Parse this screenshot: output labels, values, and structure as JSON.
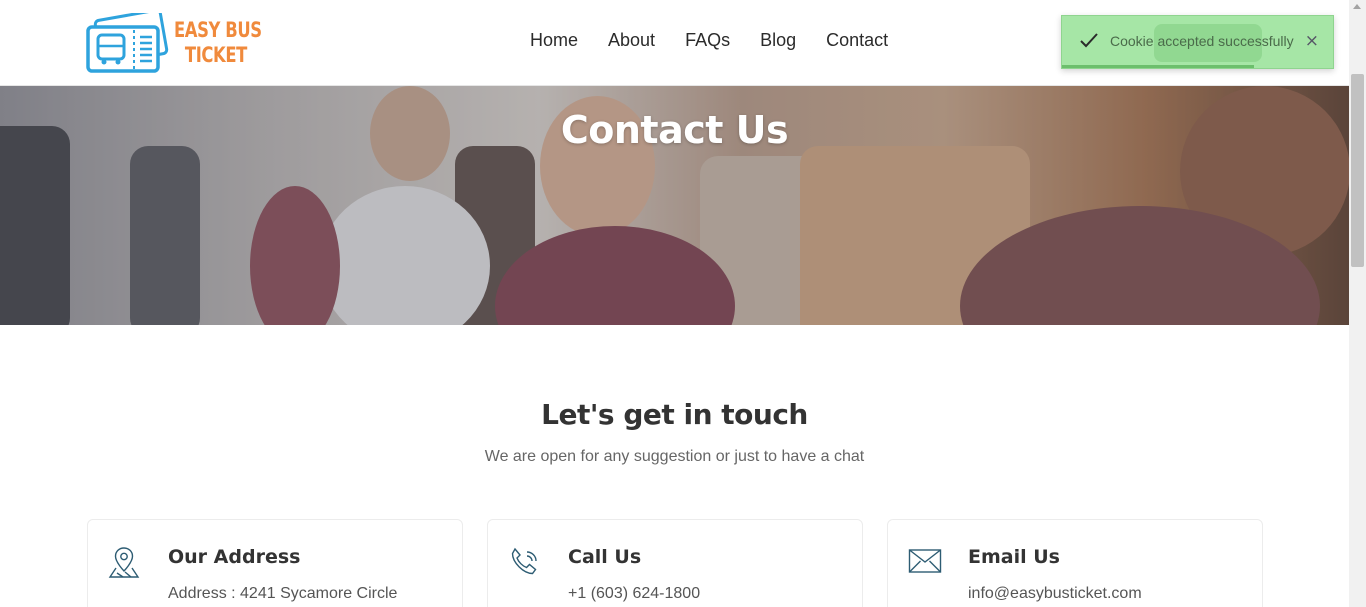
{
  "logo": {
    "line1": "EASY BUS",
    "line2": "TICKET"
  },
  "nav": {
    "items": [
      "Home",
      "About",
      "FAQs",
      "Blog",
      "Contact"
    ]
  },
  "hero": {
    "title": "Contact Us"
  },
  "touch": {
    "title": "Let's get in touch",
    "subtitle": "We are open for any suggestion or just to have a chat"
  },
  "cards": [
    {
      "title": "Our Address",
      "text": "Address : 4241 Sycamore Circle",
      "icon": "map-pin-icon"
    },
    {
      "title": "Call Us",
      "text": "+1 (603) 624-1800",
      "icon": "phone-icon"
    },
    {
      "title": "Email Us",
      "text": "info@easybusticket.com",
      "icon": "envelope-icon"
    }
  ],
  "toast": {
    "message": "Cookie accepted successfully",
    "close": "×",
    "progress": 0.71
  },
  "colors": {
    "brand_orange": "#f08a3c",
    "brand_blue": "#2ea3dd",
    "toast_bg": "#a6e6a6"
  }
}
